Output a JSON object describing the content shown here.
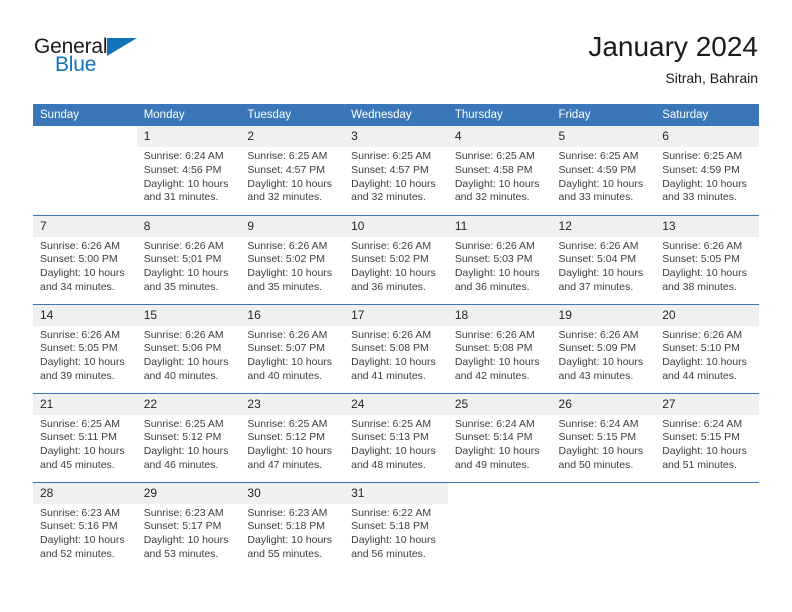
{
  "brand": {
    "name_top": "General",
    "name_bottom": "Blue",
    "accent_color": "#1273ba",
    "logo_icon": "triangle-flag-icon"
  },
  "header": {
    "title": "January 2024",
    "subtitle": "Sitrah, Bahrain"
  },
  "theme": {
    "header_row_bg": "#3a77b8",
    "daynum_bg": "#f0f0f0",
    "text_color": "#3d3d3d",
    "divider_color": "#3a77b8"
  },
  "calendar": {
    "weekday_headers": [
      "Sunday",
      "Monday",
      "Tuesday",
      "Wednesday",
      "Thursday",
      "Friday",
      "Saturday"
    ],
    "labels": {
      "sunrise": "Sunrise:",
      "sunset": "Sunset:",
      "daylight": "Daylight:"
    },
    "weeks": [
      [
        {
          "day": "",
          "empty": true
        },
        {
          "day": "1",
          "sunrise": "Sunrise: 6:24 AM",
          "sunset": "Sunset: 4:56 PM",
          "daylight1": "Daylight: 10 hours",
          "daylight2": "and 31 minutes."
        },
        {
          "day": "2",
          "sunrise": "Sunrise: 6:25 AM",
          "sunset": "Sunset: 4:57 PM",
          "daylight1": "Daylight: 10 hours",
          "daylight2": "and 32 minutes."
        },
        {
          "day": "3",
          "sunrise": "Sunrise: 6:25 AM",
          "sunset": "Sunset: 4:57 PM",
          "daylight1": "Daylight: 10 hours",
          "daylight2": "and 32 minutes."
        },
        {
          "day": "4",
          "sunrise": "Sunrise: 6:25 AM",
          "sunset": "Sunset: 4:58 PM",
          "daylight1": "Daylight: 10 hours",
          "daylight2": "and 32 minutes."
        },
        {
          "day": "5",
          "sunrise": "Sunrise: 6:25 AM",
          "sunset": "Sunset: 4:59 PM",
          "daylight1": "Daylight: 10 hours",
          "daylight2": "and 33 minutes."
        },
        {
          "day": "6",
          "sunrise": "Sunrise: 6:25 AM",
          "sunset": "Sunset: 4:59 PM",
          "daylight1": "Daylight: 10 hours",
          "daylight2": "and 33 minutes."
        }
      ],
      [
        {
          "day": "7",
          "sunrise": "Sunrise: 6:26 AM",
          "sunset": "Sunset: 5:00 PM",
          "daylight1": "Daylight: 10 hours",
          "daylight2": "and 34 minutes."
        },
        {
          "day": "8",
          "sunrise": "Sunrise: 6:26 AM",
          "sunset": "Sunset: 5:01 PM",
          "daylight1": "Daylight: 10 hours",
          "daylight2": "and 35 minutes."
        },
        {
          "day": "9",
          "sunrise": "Sunrise: 6:26 AM",
          "sunset": "Sunset: 5:02 PM",
          "daylight1": "Daylight: 10 hours",
          "daylight2": "and 35 minutes."
        },
        {
          "day": "10",
          "sunrise": "Sunrise: 6:26 AM",
          "sunset": "Sunset: 5:02 PM",
          "daylight1": "Daylight: 10 hours",
          "daylight2": "and 36 minutes."
        },
        {
          "day": "11",
          "sunrise": "Sunrise: 6:26 AM",
          "sunset": "Sunset: 5:03 PM",
          "daylight1": "Daylight: 10 hours",
          "daylight2": "and 36 minutes."
        },
        {
          "day": "12",
          "sunrise": "Sunrise: 6:26 AM",
          "sunset": "Sunset: 5:04 PM",
          "daylight1": "Daylight: 10 hours",
          "daylight2": "and 37 minutes."
        },
        {
          "day": "13",
          "sunrise": "Sunrise: 6:26 AM",
          "sunset": "Sunset: 5:05 PM",
          "daylight1": "Daylight: 10 hours",
          "daylight2": "and 38 minutes."
        }
      ],
      [
        {
          "day": "14",
          "sunrise": "Sunrise: 6:26 AM",
          "sunset": "Sunset: 5:05 PM",
          "daylight1": "Daylight: 10 hours",
          "daylight2": "and 39 minutes."
        },
        {
          "day": "15",
          "sunrise": "Sunrise: 6:26 AM",
          "sunset": "Sunset: 5:06 PM",
          "daylight1": "Daylight: 10 hours",
          "daylight2": "and 40 minutes."
        },
        {
          "day": "16",
          "sunrise": "Sunrise: 6:26 AM",
          "sunset": "Sunset: 5:07 PM",
          "daylight1": "Daylight: 10 hours",
          "daylight2": "and 40 minutes."
        },
        {
          "day": "17",
          "sunrise": "Sunrise: 6:26 AM",
          "sunset": "Sunset: 5:08 PM",
          "daylight1": "Daylight: 10 hours",
          "daylight2": "and 41 minutes."
        },
        {
          "day": "18",
          "sunrise": "Sunrise: 6:26 AM",
          "sunset": "Sunset: 5:08 PM",
          "daylight1": "Daylight: 10 hours",
          "daylight2": "and 42 minutes."
        },
        {
          "day": "19",
          "sunrise": "Sunrise: 6:26 AM",
          "sunset": "Sunset: 5:09 PM",
          "daylight1": "Daylight: 10 hours",
          "daylight2": "and 43 minutes."
        },
        {
          "day": "20",
          "sunrise": "Sunrise: 6:26 AM",
          "sunset": "Sunset: 5:10 PM",
          "daylight1": "Daylight: 10 hours",
          "daylight2": "and 44 minutes."
        }
      ],
      [
        {
          "day": "21",
          "sunrise": "Sunrise: 6:25 AM",
          "sunset": "Sunset: 5:11 PM",
          "daylight1": "Daylight: 10 hours",
          "daylight2": "and 45 minutes."
        },
        {
          "day": "22",
          "sunrise": "Sunrise: 6:25 AM",
          "sunset": "Sunset: 5:12 PM",
          "daylight1": "Daylight: 10 hours",
          "daylight2": "and 46 minutes."
        },
        {
          "day": "23",
          "sunrise": "Sunrise: 6:25 AM",
          "sunset": "Sunset: 5:12 PM",
          "daylight1": "Daylight: 10 hours",
          "daylight2": "and 47 minutes."
        },
        {
          "day": "24",
          "sunrise": "Sunrise: 6:25 AM",
          "sunset": "Sunset: 5:13 PM",
          "daylight1": "Daylight: 10 hours",
          "daylight2": "and 48 minutes."
        },
        {
          "day": "25",
          "sunrise": "Sunrise: 6:24 AM",
          "sunset": "Sunset: 5:14 PM",
          "daylight1": "Daylight: 10 hours",
          "daylight2": "and 49 minutes."
        },
        {
          "day": "26",
          "sunrise": "Sunrise: 6:24 AM",
          "sunset": "Sunset: 5:15 PM",
          "daylight1": "Daylight: 10 hours",
          "daylight2": "and 50 minutes."
        },
        {
          "day": "27",
          "sunrise": "Sunrise: 6:24 AM",
          "sunset": "Sunset: 5:15 PM",
          "daylight1": "Daylight: 10 hours",
          "daylight2": "and 51 minutes."
        }
      ],
      [
        {
          "day": "28",
          "sunrise": "Sunrise: 6:23 AM",
          "sunset": "Sunset: 5:16 PM",
          "daylight1": "Daylight: 10 hours",
          "daylight2": "and 52 minutes."
        },
        {
          "day": "29",
          "sunrise": "Sunrise: 6:23 AM",
          "sunset": "Sunset: 5:17 PM",
          "daylight1": "Daylight: 10 hours",
          "daylight2": "and 53 minutes."
        },
        {
          "day": "30",
          "sunrise": "Sunrise: 6:23 AM",
          "sunset": "Sunset: 5:18 PM",
          "daylight1": "Daylight: 10 hours",
          "daylight2": "and 55 minutes."
        },
        {
          "day": "31",
          "sunrise": "Sunrise: 6:22 AM",
          "sunset": "Sunset: 5:18 PM",
          "daylight1": "Daylight: 10 hours",
          "daylight2": "and 56 minutes."
        },
        {
          "day": "",
          "empty": true
        },
        {
          "day": "",
          "empty": true
        },
        {
          "day": "",
          "empty": true
        }
      ]
    ]
  }
}
